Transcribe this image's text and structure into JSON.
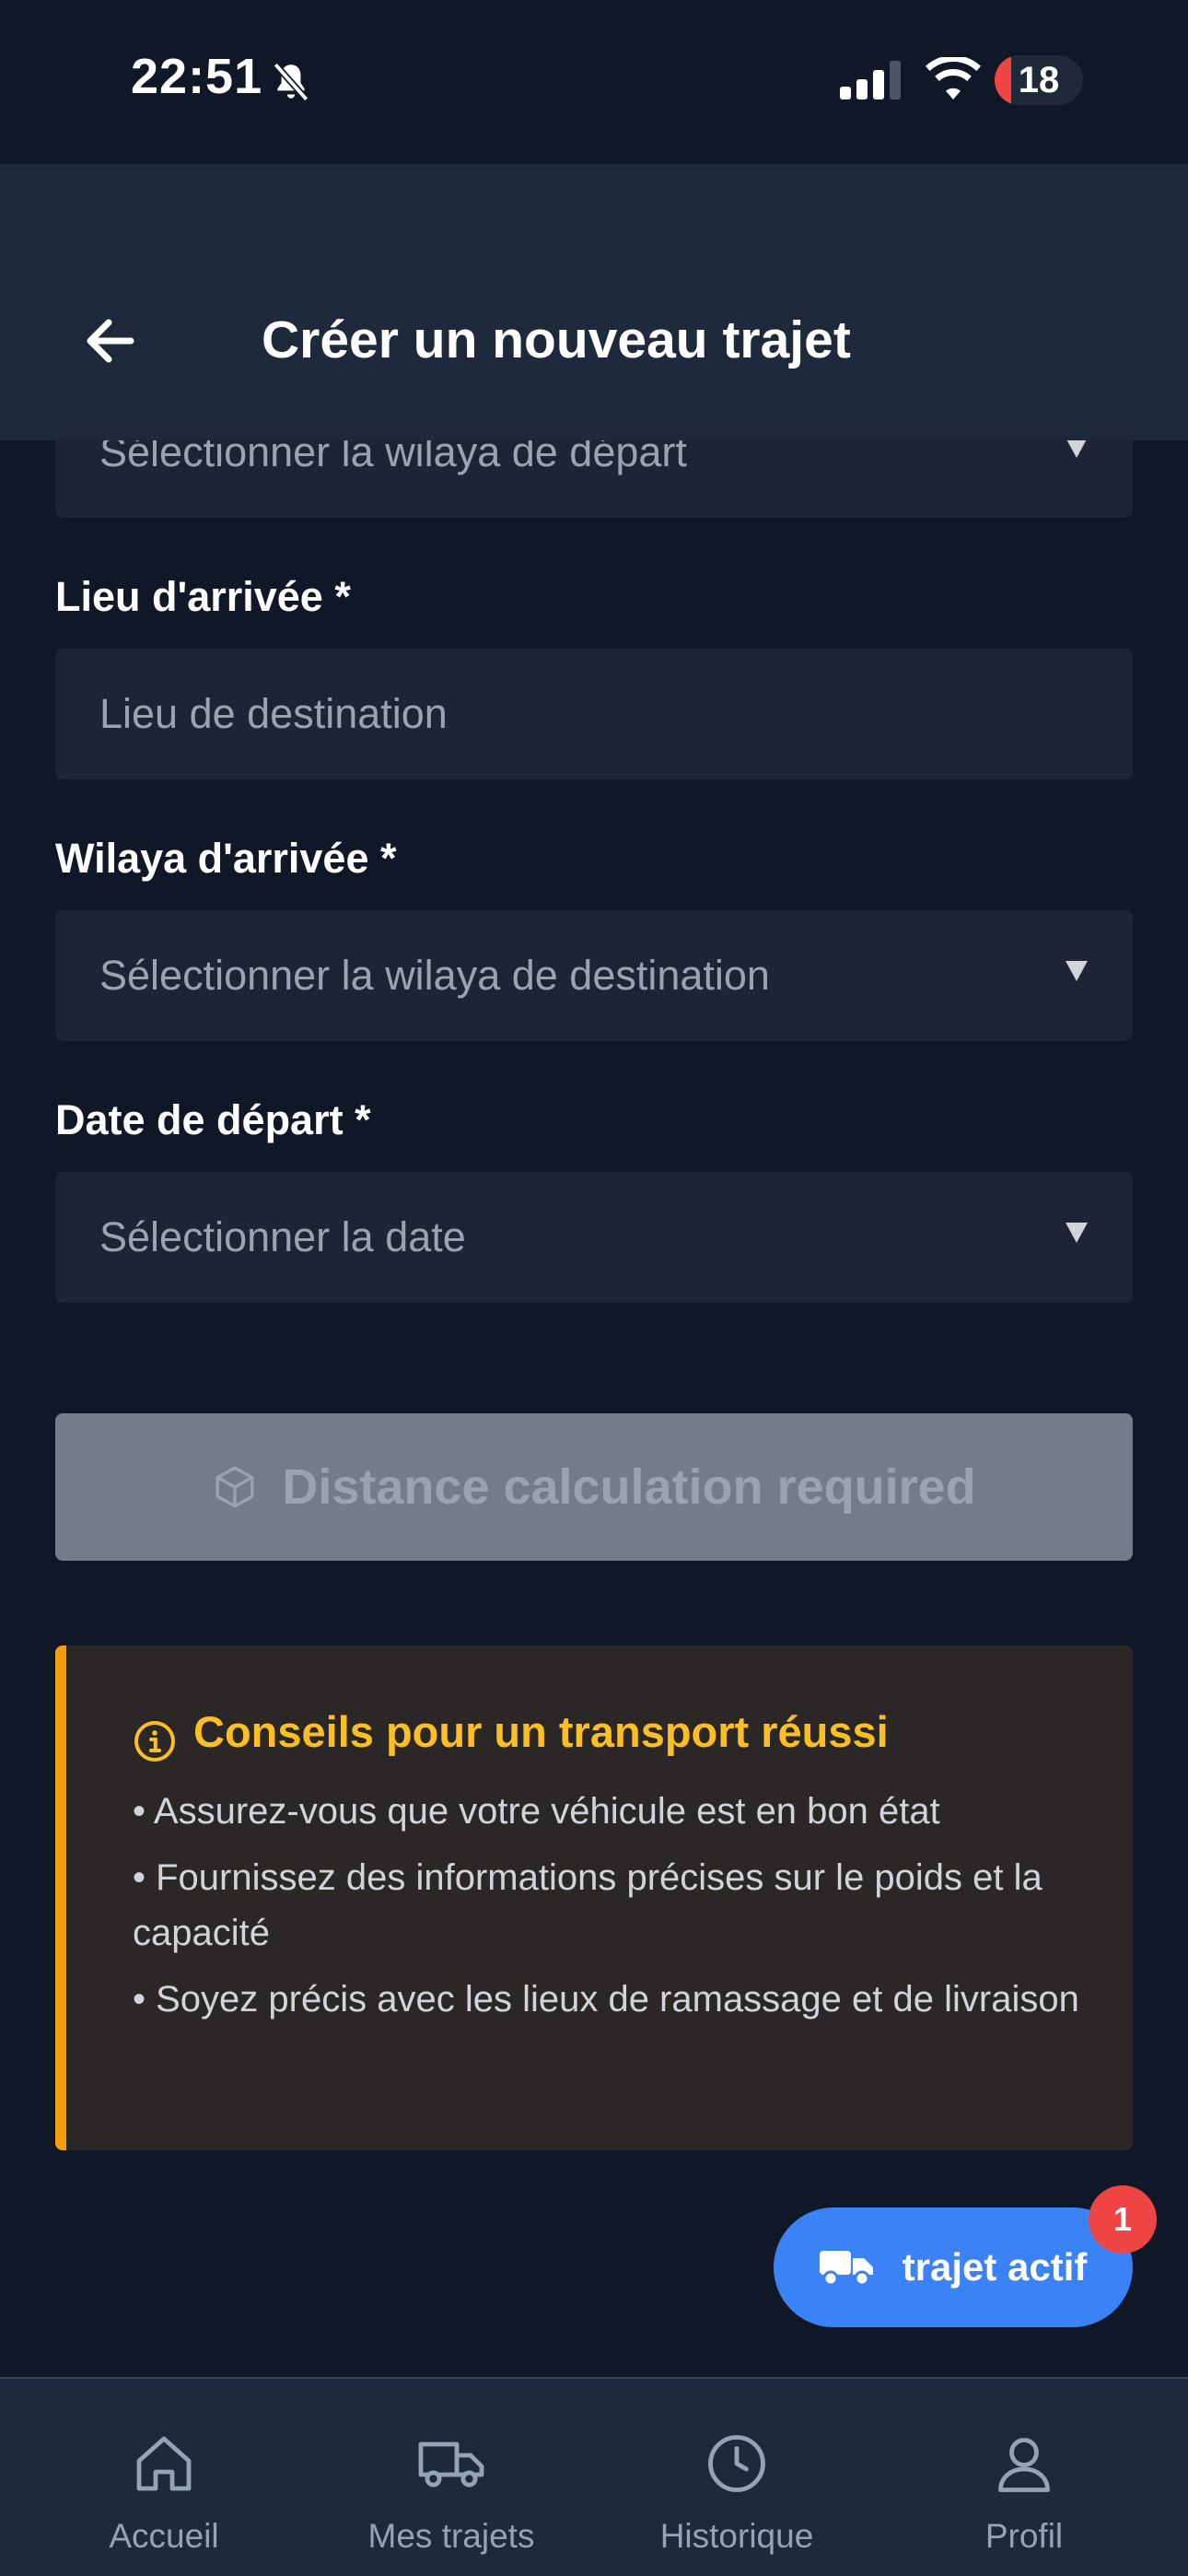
{
  "status_bar": {
    "time": "22:51",
    "battery": "18"
  },
  "header": {
    "title": "Créer un nouveau trajet"
  },
  "form": {
    "departure_wilaya_placeholder": "Sélectionner la wilaya de départ",
    "arrival_place_label": "Lieu d'arrivée *",
    "arrival_place_placeholder": "Lieu de destination",
    "arrival_wilaya_label": "Wilaya d'arrivée *",
    "arrival_wilaya_placeholder": "Sélectionner la wilaya de destination",
    "departure_date_label": "Date de départ *",
    "departure_date_placeholder": "Sélectionner la date"
  },
  "calc_button": {
    "label": "Distance calculation required"
  },
  "tips": {
    "title": "Conseils pour un transport réussi",
    "items": [
      "• Assurez-vous que votre véhicule est en bon état",
      "• Fournissez des informations précises sur le poids et la capacité",
      "• Soyez précis avec les lieux de ramassage et de livraison"
    ]
  },
  "fab": {
    "label": "trajet actif",
    "badge": "1"
  },
  "bottom_nav": {
    "items": [
      {
        "label": "Accueil",
        "icon": "home-icon"
      },
      {
        "label": "Mes trajets",
        "icon": "truck-icon"
      },
      {
        "label": "Historique",
        "icon": "clock-icon"
      },
      {
        "label": "Profil",
        "icon": "user-icon"
      }
    ]
  },
  "colors": {
    "background": "#101828",
    "header": "#1e293b",
    "accent": "#3b82f6",
    "warning": "#f59e0b",
    "badge": "#ef4444"
  }
}
